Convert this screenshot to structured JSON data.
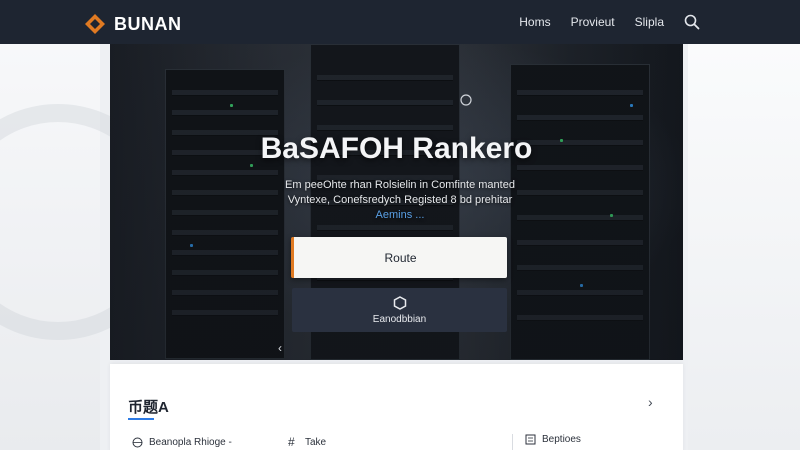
{
  "brand": {
    "name": "BUNAN",
    "accent": "#e07a22",
    "logo_icon": "diamond-logo-icon"
  },
  "nav": {
    "links": [
      "Homs",
      "Provieut",
      "Slipla"
    ],
    "search_icon": "search-icon"
  },
  "hero": {
    "title": "BaSAFOH Rankero",
    "subtitle_line1": "Em peeOhte rhan Rolsielin in Comfinte manted",
    "subtitle_line2": "Vyntexe, Conefsredych Registed 8 bd prehitar",
    "subtitle_link": "Aemins ...",
    "primary_button": "Route",
    "secondary_button": "Eanodbbian",
    "secondary_icon": "hexagon-icon",
    "prev_icon": "chevron-left-icon"
  },
  "card": {
    "title": "币题A",
    "chevron_icon": "chevron-right-icon",
    "items": [
      {
        "icon": "globe-icon",
        "label": "Beanopla Rhioge -"
      },
      {
        "icon": "hash-icon",
        "label": "Take"
      },
      {
        "icon": "grid-icon",
        "label": "Beptioes"
      }
    ]
  }
}
